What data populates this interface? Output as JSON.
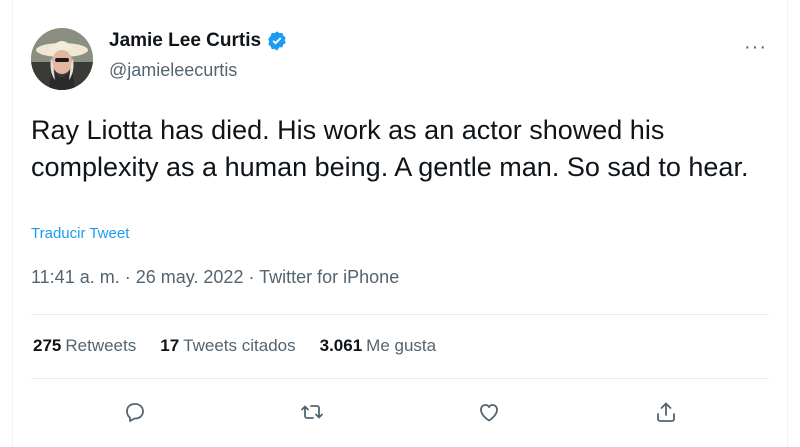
{
  "author": {
    "name": "Jamie Lee Curtis",
    "handle": "@jamieleecurtis",
    "verified": true
  },
  "tweet": {
    "text": "Ray Liotta has died. His work as an actor showed his complexity as a human being. A gentle man. So sad to hear.",
    "translate_label": "Traducir Tweet",
    "time": "11:41 a. m.",
    "separator": " · ",
    "date": "26 may. 2022",
    "source": "Twitter for iPhone"
  },
  "stats": {
    "retweets_count": "275",
    "retweets_label": "Retweets",
    "quotes_count": "17",
    "quotes_label": "Tweets citados",
    "likes_count": "3.061",
    "likes_label": "Me gusta"
  },
  "menu": {
    "more_label": "···"
  },
  "icons": {
    "reply": "reply-icon",
    "retweet": "retweet-icon",
    "like": "heart-icon",
    "share": "share-icon",
    "verified": "verified-badge-icon"
  },
  "colors": {
    "accent": "#1d9bf0",
    "secondary_text": "#536471",
    "primary_text": "#0f1419"
  }
}
